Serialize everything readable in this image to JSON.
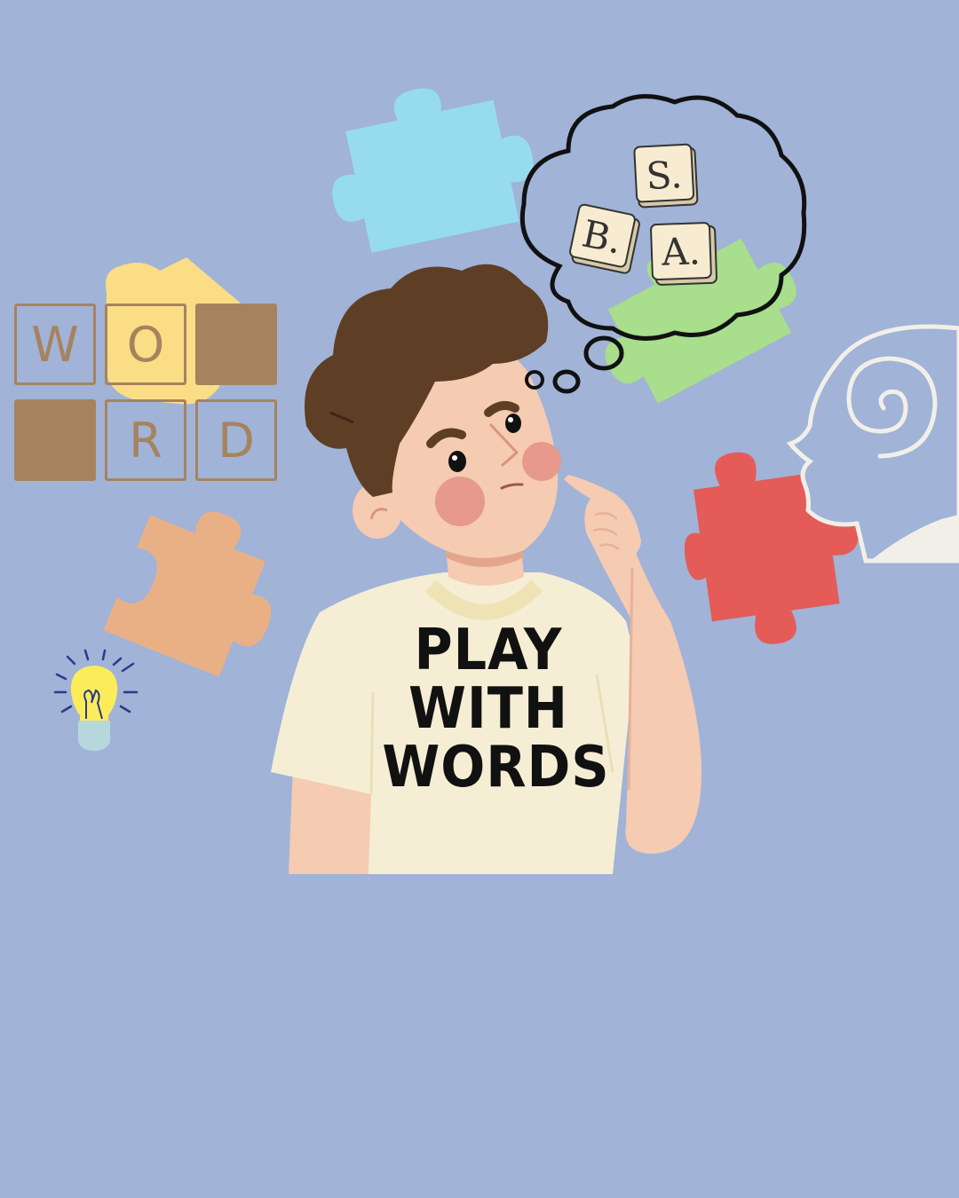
{
  "background_color": "#a1b3d7",
  "word_tiles": [
    {
      "letter": "W",
      "filled": false
    },
    {
      "letter": "O",
      "filled": false
    },
    {
      "letter": "",
      "filled": true
    },
    {
      "letter": "",
      "filled": true
    },
    {
      "letter": "R",
      "filled": false
    },
    {
      "letter": "D",
      "filled": false
    }
  ],
  "thought_tiles": [
    "S.",
    "B.",
    "A."
  ],
  "shirt_lines": [
    "PLAY",
    "WITH",
    "WORDS"
  ],
  "colors": {
    "tile_brown": "#a6835e",
    "puzzle_blue": "#96dbee",
    "puzzle_yellow": "#fbdd86",
    "puzzle_green": "#a8de8c",
    "puzzle_red": "#e45b58",
    "puzzle_peach": "#eab085",
    "hair": "#5e3f26",
    "skin": "#f5cbb2",
    "shirt": "#f5eed5"
  }
}
